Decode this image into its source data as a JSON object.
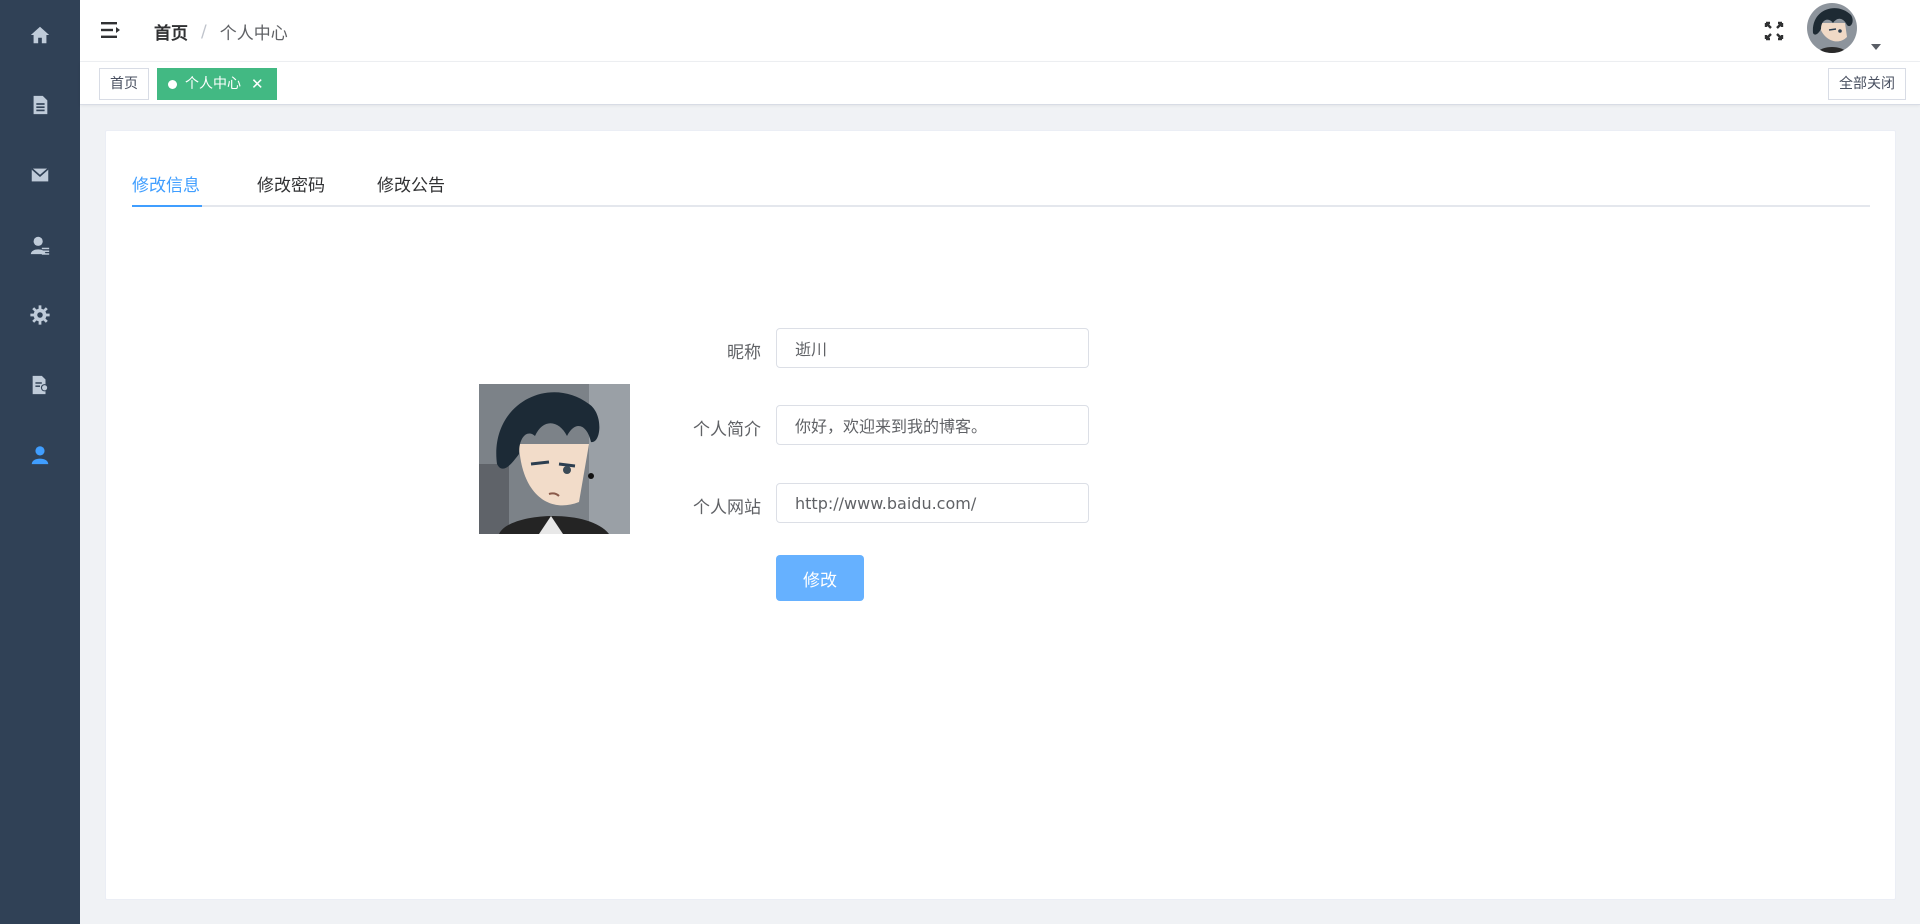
{
  "sidebar": {
    "items": [
      {
        "icon": "home-icon",
        "active": false
      },
      {
        "icon": "document-icon",
        "active": false
      },
      {
        "icon": "mail-icon",
        "active": false
      },
      {
        "icon": "user-manage-icon",
        "active": false
      },
      {
        "icon": "gear-icon",
        "active": false
      },
      {
        "icon": "report-icon",
        "active": false
      },
      {
        "icon": "user-icon",
        "active": true
      }
    ],
    "colors": {
      "bg": "#304156",
      "icon": "#bfcbd9",
      "active": "#409eff"
    }
  },
  "header": {
    "breadcrumb": {
      "home": "首页",
      "separator": "/",
      "current": "个人中心"
    }
  },
  "tags": {
    "home": "首页",
    "active": "个人中心",
    "close_symbol": "✕",
    "close_all": "全部关闭",
    "active_color": "#42b983"
  },
  "tabs": [
    {
      "label": "修改信息",
      "active": true
    },
    {
      "label": "修改密码",
      "active": false
    },
    {
      "label": "修改公告",
      "active": false
    }
  ],
  "form": {
    "nickname_label": "昵称",
    "nickname_value": "逝川",
    "bio_label": "个人简介",
    "bio_value": "你好，欢迎来到我的博客。",
    "website_label": "个人网站",
    "website_value": "http://www.baidu.com/",
    "submit_label": "修改"
  },
  "accent_color": "#409eff"
}
